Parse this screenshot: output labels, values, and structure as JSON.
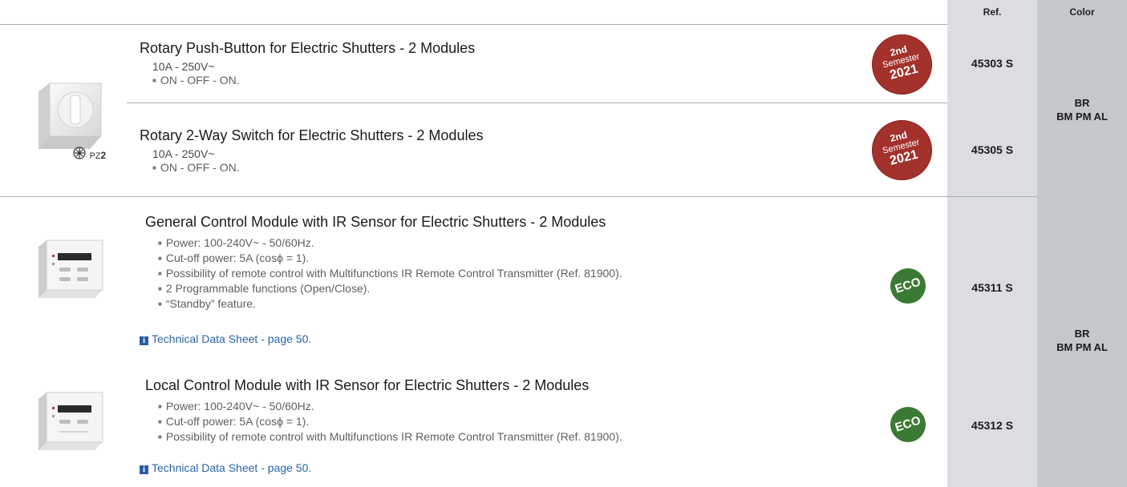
{
  "header": {
    "ref_label": "Ref.",
    "color_label": "Color"
  },
  "products": [
    {
      "title": "Rotary Push-Button for Electric Shutters - 2 Modules",
      "rating": "10A - 250V~",
      "bullets": [
        "ON - OFF - ON."
      ],
      "badge": {
        "line1": "2nd",
        "line2": "Semester",
        "line3": "2021"
      },
      "ref": "45303 S"
    },
    {
      "title": "Rotary 2-Way Switch for Electric Shutters - 2 Modules",
      "rating": "10A - 250V~",
      "bullets": [
        "ON - OFF - ON."
      ],
      "badge": {
        "line1": "2nd",
        "line2": "Semester",
        "line3": "2021"
      },
      "ref": "45305 S"
    },
    {
      "title": "General Control Module with IR Sensor for Electric Shutters - 2 Modules",
      "bullets": [
        "Power: 100-240V~ - 50/60Hz.",
        "Cut-off power: 5A (cosϕ = 1).",
        "Possibility of remote control with Multifunctions IR Remote Control Transmitter (Ref. 81900).",
        "2 Programmable functions (Open/Close).",
        "“Standby” feature."
      ],
      "link": "Technical Data Sheet - page 50.",
      "badge": {
        "text": "ECO"
      },
      "ref": "45311 S"
    },
    {
      "title": "Local Control Module with IR Sensor for Electric Shutters - 2 Modules",
      "bullets": [
        "Power: 100-240V~ - 50/60Hz.",
        "Cut-off power: 5A (cosϕ = 1).",
        "Possibility of remote control with Multifunctions IR Remote Control Transmitter (Ref. 81900)."
      ],
      "link": "Technical Data Sheet - page 50.",
      "badge": {
        "text": "ECO"
      },
      "ref": "45312 S"
    }
  ],
  "groups": [
    {
      "color_line1": "BR",
      "color_line2": "BM PM AL",
      "tool": {
        "label": "PZ",
        "number": "2"
      }
    },
    {
      "color_line1": "BR",
      "color_line2": "BM PM AL"
    }
  ],
  "info_icon_glyph": "i",
  "colors": {
    "semester_badge": "#a3312c",
    "eco_badge": "#3b7a34",
    "link": "#2a66a8"
  }
}
